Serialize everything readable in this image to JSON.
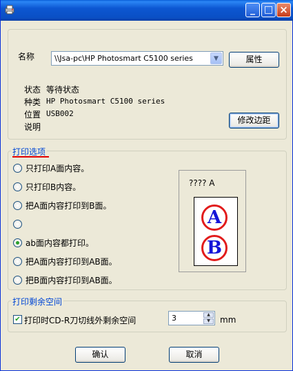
{
  "window": {
    "buttons": {
      "minimize": "_",
      "maximize": "□",
      "close": "×"
    }
  },
  "printer": {
    "name_label": "名称",
    "name_value": "\\\\Jsa-pc\\HP Photosmart C5100 series",
    "properties_button": "属性",
    "status_label": "状态",
    "status_value": "等待状态",
    "type_label": "种类",
    "type_value": "HP Photosmart C5100 series",
    "location_label": "位置",
    "location_value": "USB002",
    "comment_label": "说明",
    "margin_button": "修改边距"
  },
  "print_options": {
    "title": "打印选项",
    "options": [
      {
        "label": "只打印A面内容。",
        "checked": false
      },
      {
        "label": "只打印B内容。",
        "checked": false
      },
      {
        "label": "把A面内容打印到B面。",
        "checked": false
      },
      {
        "label": "",
        "checked": false
      },
      {
        "label": "ab面内容都打印。",
        "checked": true
      },
      {
        "label": "把A面内容打印到AB面。",
        "checked": false
      },
      {
        "label": "把B面内容打印到AB面。",
        "checked": false
      }
    ],
    "preview": {
      "title": "???? A",
      "letter_top": "A",
      "letter_bottom": "B"
    }
  },
  "remaining_space": {
    "title": "打印剩余空间",
    "checkbox_label": "打印时CD-R刀切线外剩余空间",
    "checkbox_checked": true,
    "value": "3",
    "unit": "mm"
  },
  "footer": {
    "ok_button": "确认",
    "cancel_button": "取消"
  },
  "colors": {
    "accent": "#0046d5",
    "underline": "#e00000",
    "titlebar": "#0a4fc4"
  }
}
